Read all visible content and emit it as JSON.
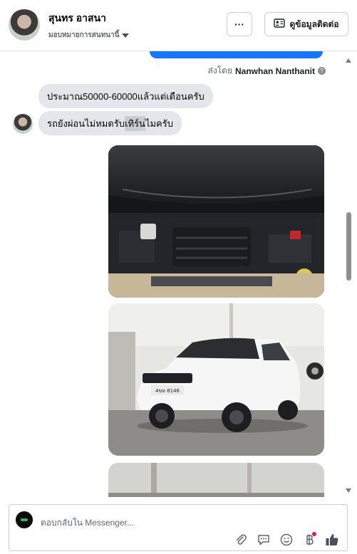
{
  "header": {
    "name": "สุนทร อาสนา",
    "assign_label": "มอบหมายการสนทนานี้",
    "more_label": "···",
    "contact_label": "ดูข้อมูลติดต่อ"
  },
  "chat": {
    "sent_by_prefix": "ส่งโดย",
    "sent_by_name": "Nanwhan Nanthanit",
    "info_icon_glyph": "?",
    "messages": [
      {
        "text": "ประมาณ50000-60000แล้วแต่เดือนครับ"
      },
      {
        "text_before": "รถยังผ่อนไม่หมดรับ",
        "highlight": "เทิร์น",
        "text_after": "ไมครับ"
      }
    ],
    "photos": [
      {
        "subject": "engine bay"
      },
      {
        "subject": "white SUV",
        "plate": "4ขห 8146"
      },
      {
        "subject": "car interior"
      }
    ]
  },
  "composer": {
    "placeholder": "ตอบกลับใน Messenger..."
  },
  "icons": {
    "more": "more-icon",
    "contact": "contact-card-icon",
    "attach": "paperclip-icon",
    "quick_reply": "chat-bubble-icon",
    "emoji": "smiley-icon",
    "payment": "baht-icon",
    "like": "thumbs-up-icon"
  }
}
